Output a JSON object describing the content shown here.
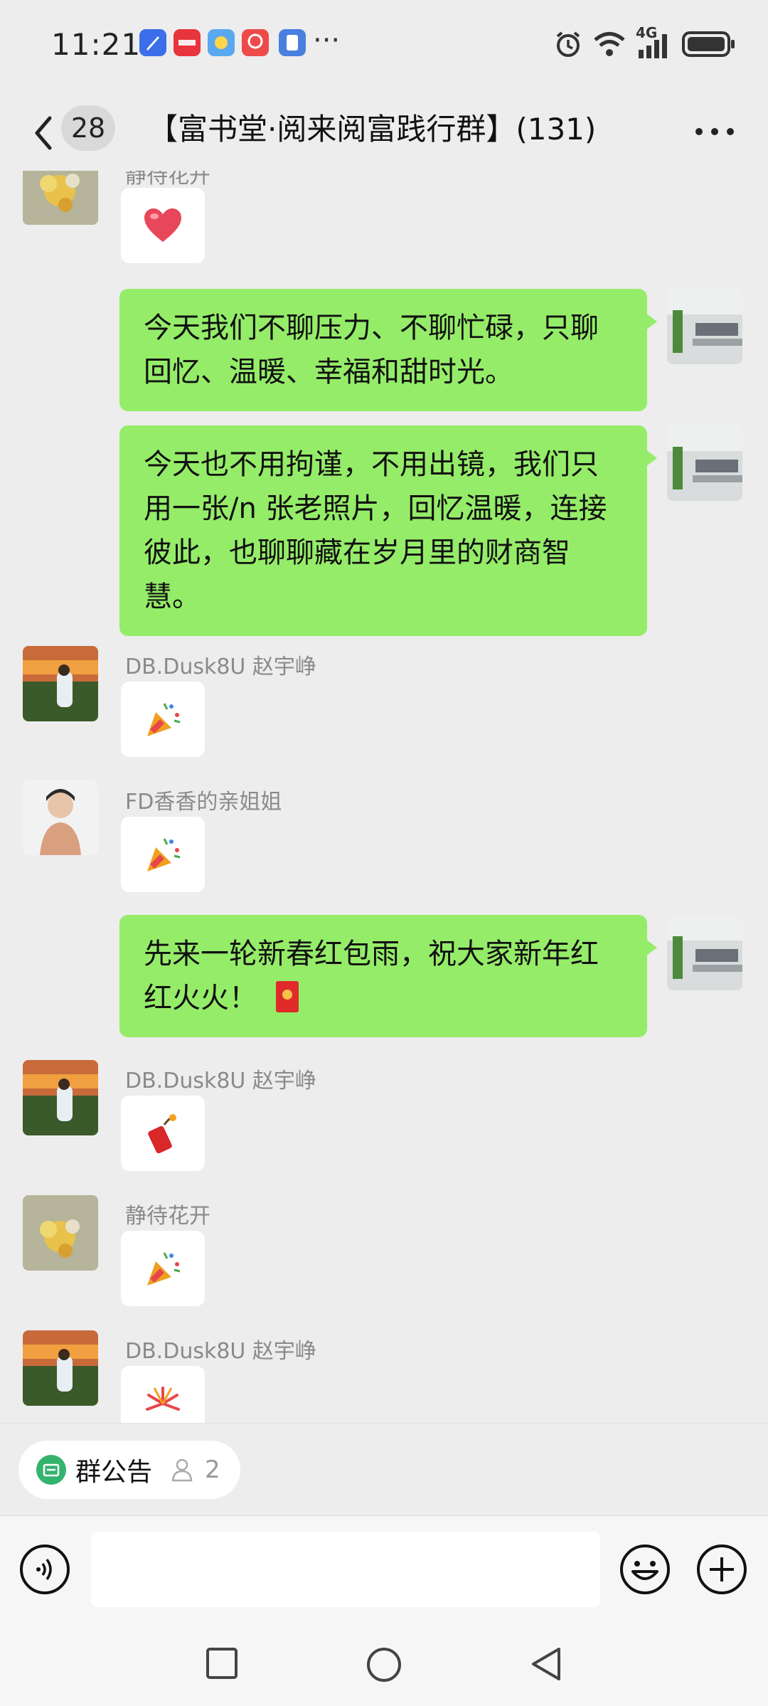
{
  "status_bar": {
    "time": "11:21",
    "app_icons": [
      "compass-app-icon",
      "xiaohongshu-app-icon",
      "weather-app-icon",
      "health-app-icon",
      "id-app-icon"
    ],
    "more_dots": "···",
    "network": "4G",
    "battery": "full"
  },
  "header": {
    "unread_count": "28",
    "title": "【富书堂·阅来阅富践行群】(131)"
  },
  "messages": [
    {
      "type": "incoming_emoji",
      "sender": "静待花开",
      "emoji": "heart"
    },
    {
      "type": "outgoing_text",
      "text": "今天我们不聊压力、不聊忙碌，只聊回忆、温暖、幸福和甜时光。"
    },
    {
      "type": "outgoing_text",
      "text": "今天也不用拘谨，不用出镜，我们只用一张/n 张老照片，回忆温暖，连接彼此，也聊聊藏在岁月里的财商智慧。"
    },
    {
      "type": "incoming_emoji",
      "sender": "DB.Dusk8U 赵宇峥",
      "emoji": "party-popper"
    },
    {
      "type": "incoming_emoji",
      "sender": "FD香香的亲姐姐",
      "emoji": "party-popper"
    },
    {
      "type": "outgoing_text",
      "text": "先来一轮新春红包雨，祝大家新年红红火火！"
    },
    {
      "type": "incoming_emoji",
      "sender": "DB.Dusk8U 赵宇峥",
      "emoji": "firecracker"
    },
    {
      "type": "incoming_emoji",
      "sender": "静待花开",
      "emoji": "party-popper"
    },
    {
      "type": "incoming_emoji",
      "sender": "DB.Dusk8U 赵宇峥",
      "emoji": "fireworks"
    }
  ],
  "notice": {
    "label": "群公告",
    "member_count": "2"
  },
  "input": {
    "placeholder": "",
    "value": ""
  },
  "colors": {
    "outgoing_bubble": "#95ec69",
    "incoming_bubble": "#ffffff",
    "background": "#ededed",
    "notice_icon": "#34b36c"
  }
}
